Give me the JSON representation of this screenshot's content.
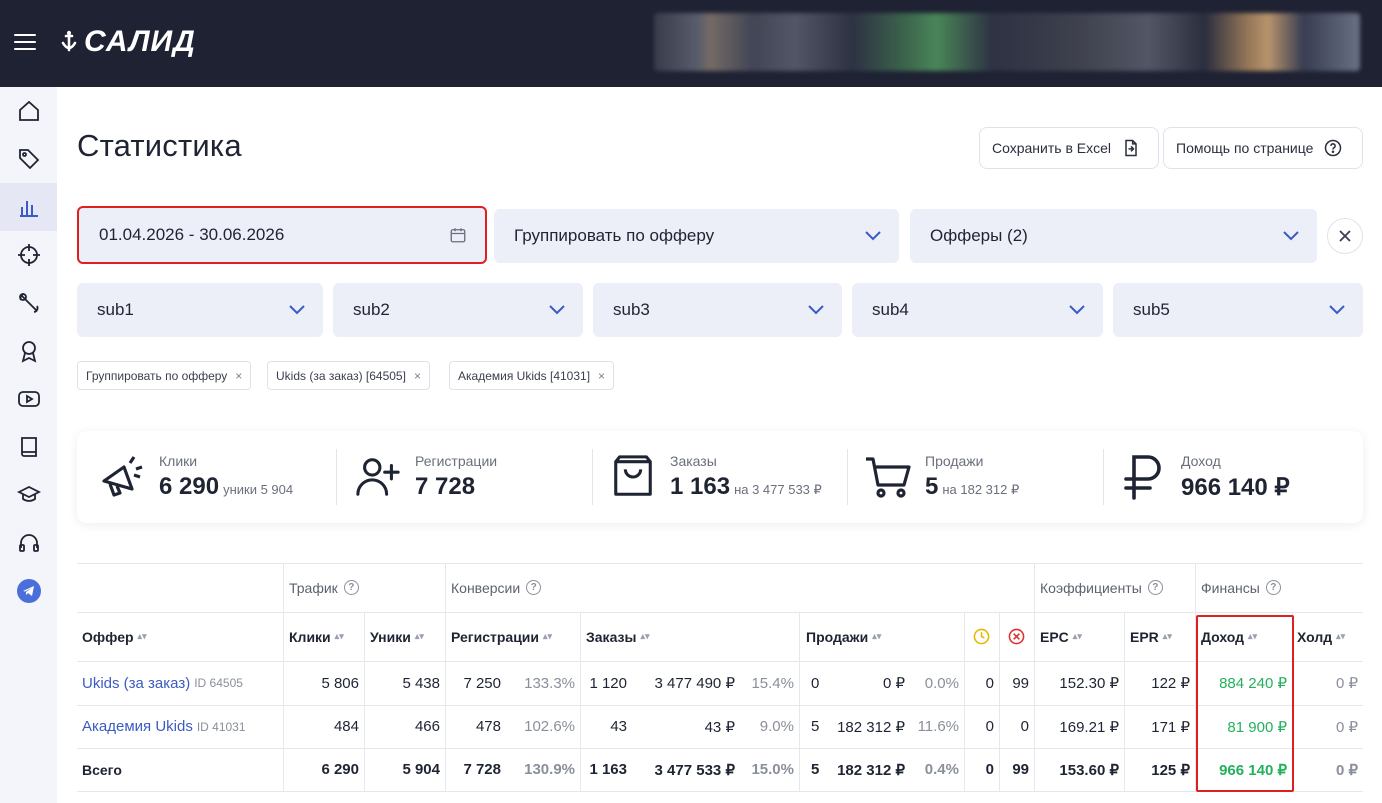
{
  "header": {
    "logo_text": "САЛИД"
  },
  "page": {
    "title": "Статистика",
    "export_button": "Сохранить в Excel",
    "help_button": "Помощь по странице"
  },
  "filters": {
    "date_range": "01.04.2026 - 30.06.2026",
    "group_by": "Группировать по офферу",
    "offers": "Офферы (2)",
    "subs": [
      "sub1",
      "sub2",
      "sub3",
      "sub4",
      "sub5"
    ]
  },
  "chips": [
    "Группировать по офферу",
    "Ukids (за заказ) [64505]",
    "Академия Ukids [41031]"
  ],
  "chip_close": "×",
  "stats": [
    {
      "label": "Клики",
      "value": "6 290",
      "sub": "уники 5 904",
      "icon": "megaphone-icon"
    },
    {
      "label": "Регистрации",
      "value": "7 728",
      "sub": "",
      "icon": "user-plus-icon"
    },
    {
      "label": "Заказы",
      "value": "1 163",
      "sub": "на 3 477 533 ₽",
      "icon": "shopping-bag-icon"
    },
    {
      "label": "Продажи",
      "value": "5",
      "sub": "на 182 312 ₽",
      "icon": "cart-icon"
    },
    {
      "label": "Доход",
      "value": "966 140 ₽",
      "sub": "",
      "icon": "ruble-icon"
    }
  ],
  "table": {
    "groups": {
      "traffic": "Трафик",
      "conversions": "Конверсии",
      "coefficients": "Коэффициенты",
      "finance": "Финансы"
    },
    "columns": {
      "offer": "Оффер",
      "clicks": "Клики",
      "uniques": "Уники",
      "registrations": "Регистрации",
      "orders": "Заказы",
      "sales": "Продажи",
      "epc": "EPC",
      "epr": "EPR",
      "income": "Доход",
      "hold": "Холд"
    },
    "rows": [
      {
        "offer": "Ukids (за заказ)",
        "offer_id": "ID 64505",
        "clicks": "5 806",
        "uniques": "5 438",
        "reg": "7 250",
        "reg_pct": "133.3%",
        "orders": "1 120",
        "orders_sum": "3 477 490 ₽",
        "orders_pct": "15.4%",
        "sales": "0",
        "sales_sum": "0 ₽",
        "sales_pct": "0.0%",
        "pending": "0",
        "rejected": "99",
        "epc": "152.30 ₽",
        "epr": "122 ₽",
        "income": "884 240 ₽",
        "hold": "0 ₽"
      },
      {
        "offer": "Академия Ukids",
        "offer_id": "ID 41031",
        "clicks": "484",
        "uniques": "466",
        "reg": "478",
        "reg_pct": "102.6%",
        "orders": "43",
        "orders_sum": "43 ₽",
        "orders_pct": "9.0%",
        "sales": "5",
        "sales_sum": "182 312 ₽",
        "sales_pct": "11.6%",
        "pending": "0",
        "rejected": "0",
        "epc": "169.21 ₽",
        "epr": "171 ₽",
        "income": "81 900 ₽",
        "hold": "0 ₽"
      }
    ],
    "total": {
      "offer": "Всего",
      "clicks": "6 290",
      "uniques": "5 904",
      "reg": "7 728",
      "reg_pct": "130.9%",
      "orders": "1 163",
      "orders_sum": "3 477 533 ₽",
      "orders_pct": "15.0%",
      "sales": "5",
      "sales_sum": "182 312 ₽",
      "sales_pct": "0.4%",
      "pending": "0",
      "rejected": "99",
      "epc": "153.60 ₽",
      "epr": "125 ₽",
      "income": "966 140 ₽",
      "hold": "0 ₽"
    }
  },
  "colors": {
    "topbar": "#1e2233",
    "accent": "#3b5bc4",
    "income_green": "#23b15c",
    "highlight_red": "#e02020",
    "pending_yellow": "#e6b800",
    "rejected_red": "#e03030"
  }
}
